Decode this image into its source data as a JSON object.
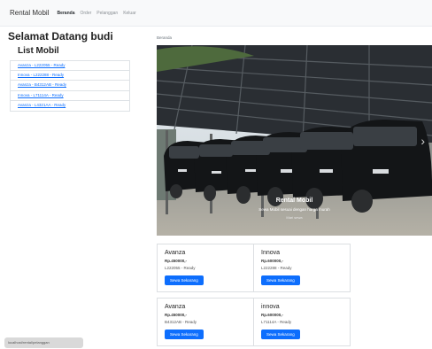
{
  "navbar": {
    "brand": "Rental Mobil",
    "links": [
      "Beranda",
      "Order",
      "Pelanggan",
      "Keluar"
    ]
  },
  "sidebar": {
    "greeting": "Selamat Datang budi",
    "title": "List Mobil",
    "items": [
      "Avanza - L222055 - Ready",
      "Innova - L222288 - Ready",
      "Avanza - B4312AB - Ready",
      "Innova - L71114A - Ready",
      "Avanza - L4321AA - Ready"
    ]
  },
  "breadcrumb": "Beranda",
  "carousel": {
    "title": "Rental Mobil",
    "text": "Sewa Mobil sesuai dengan harga murah",
    "sub": "Mari sewa",
    "next_icon": "chevron-right-icon"
  },
  "cards": [
    {
      "title": "Avanza",
      "price": "Rp.450000,-",
      "status": "L222055 - Ready",
      "button": "Sewa Sekarang"
    },
    {
      "title": "Innova",
      "price": "Rp.600000,-",
      "status": "L222288 - Ready",
      "button": "Sewa Sekarang"
    },
    {
      "title": "Avanza",
      "price": "Rp.450000,-",
      "status": "B4312AB - Ready",
      "button": "Sewa Sekarang"
    },
    {
      "title": "innova",
      "price": "Rp.600000,-",
      "status": "L71114A - Ready",
      "button": "Sewa Sekarang"
    }
  ],
  "status_bar": "localhost/rental/pelanggan",
  "colors": {
    "primary": "#0d6efd",
    "navbar_bg": "#f8f9fa"
  }
}
